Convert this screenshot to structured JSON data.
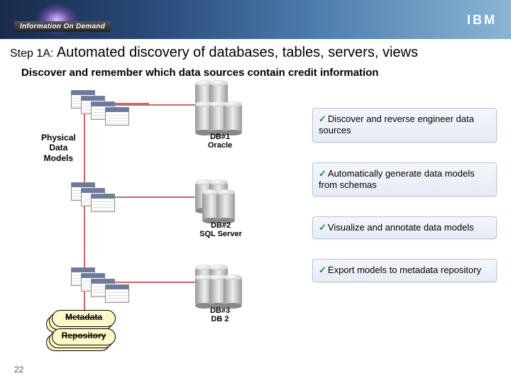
{
  "banner": {
    "tag": "Information On Demand",
    "logo": "IBM"
  },
  "title": {
    "step": "Step 1A:",
    "text": "Automated discovery of databases, tables, servers, views"
  },
  "subtitle": "Discover and remember which data sources contain credit information",
  "labels": {
    "pdm": "Physical\nData\nModels",
    "db1": "DB#1\nOracle",
    "db2": "DB#2\nSQL Server",
    "db3": "DB#3\nDB 2",
    "repo1": "Metadata",
    "repo2": "Repository"
  },
  "bullets": [
    "Discover and reverse engineer data sources",
    "Automatically generate data models from schemas",
    "Visualize and annotate data models",
    "Export models to metadata repository"
  ],
  "page": "22"
}
